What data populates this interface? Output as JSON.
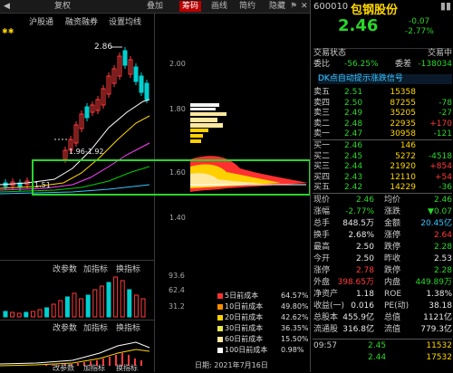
{
  "toolbar": {
    "back": "◀",
    "reinstate": "复权",
    "overlay": "叠加",
    "chips": "筹码",
    "draw": "画线",
    "brief": "简约",
    "hide": "隐藏",
    "flag": "⚑",
    "close": "✕"
  },
  "subtabs": {
    "hgt": "沪股通",
    "margin": "融资融券",
    "settings": "设置均线"
  },
  "price_axis": [
    "2.00",
    "1.80",
    "1.60",
    "1.40"
  ],
  "kline_labels": {
    "high": "2.86",
    "mid": "1.96-1.92",
    "low": "1.51",
    "stars": "✱✱"
  },
  "indicator": {
    "params": "改参数",
    "add": "加指标",
    "switch": "换指标"
  },
  "vol_axis": [
    "93.6",
    "62.4",
    "31.2"
  ],
  "chips_legend": [
    {
      "label": "5日前成本",
      "value": "64.57%",
      "color": "#ff3030"
    },
    {
      "label": "10日前成本",
      "value": "49.80%",
      "color": "#ff8c00"
    },
    {
      "label": "20日前成本",
      "value": "42.62%",
      "color": "#ffd000"
    },
    {
      "label": "30日前成本",
      "value": "36.35%",
      "color": "#e8e850"
    },
    {
      "label": "60日前成本",
      "value": "15.50%",
      "color": "#ffe8a0"
    },
    {
      "label": "100日前成本",
      "value": "0.98%",
      "color": "#ffffff"
    }
  ],
  "chips_date": "日期: 2021年7月16日",
  "quote": {
    "code": "600010",
    "name": "包钢股份",
    "price": "2.46",
    "change": "-0.07",
    "pct": "-2.77%",
    "status_label": "交易状态",
    "status_value": "交易中",
    "weibi_label": "委比",
    "weibi_pct": "-56.25%",
    "weibi_label2": "委差",
    "weibi_diff": "-138034",
    "signal": "DK点自动提示涨跌信号",
    "asks": [
      {
        "label": "卖五",
        "price": "2.51",
        "vol": "15358",
        "chg": ""
      },
      {
        "label": "卖四",
        "price": "2.50",
        "vol": "87255",
        "chg": "-78"
      },
      {
        "label": "卖三",
        "price": "2.49",
        "vol": "35205",
        "chg": "-27"
      },
      {
        "label": "卖二",
        "price": "2.48",
        "vol": "22935",
        "chg": "+170"
      },
      {
        "label": "卖一",
        "price": "2.47",
        "vol": "30958",
        "chg": "-121"
      }
    ],
    "bids": [
      {
        "label": "买一",
        "price": "2.46",
        "vol": "146",
        "chg": ""
      },
      {
        "label": "买二",
        "price": "2.45",
        "vol": "5272",
        "chg": "-4518"
      },
      {
        "label": "买三",
        "price": "2.44",
        "vol": "21920",
        "chg": "+854"
      },
      {
        "label": "买四",
        "price": "2.43",
        "vol": "12110",
        "chg": "+54"
      },
      {
        "label": "买五",
        "price": "2.42",
        "vol": "14229",
        "chg": "-36"
      }
    ],
    "stats": [
      {
        "l1": "现价",
        "v1": "2.46",
        "c1": "g",
        "l2": "均价",
        "v2": "2.46",
        "c2": "g"
      },
      {
        "l1": "涨幅",
        "v1": "-2.77%",
        "c1": "g",
        "l2": "涨跌",
        "v2": "▼0.07",
        "c2": "g"
      },
      {
        "l1": "总手",
        "v1": "848.5万",
        "c1": "w",
        "l2": "金额",
        "v2": "20.45亿",
        "c2": "c"
      },
      {
        "l1": "换手",
        "v1": "2.68%",
        "c1": "w",
        "l2": "涨停",
        "v2": "2.64",
        "c2": "r"
      },
      {
        "l1": "最高",
        "v1": "2.50",
        "c1": "w",
        "l2": "跌停",
        "v2": "2.28",
        "c2": "g"
      },
      {
        "l1": "今开",
        "v1": "2.50",
        "c1": "w",
        "l2": "昨收",
        "v2": "2.53",
        "c2": "w"
      },
      {
        "l1": "涨停",
        "v1": "2.78",
        "c1": "r",
        "l2": "跌停",
        "v2": "2.28",
        "c2": "g"
      },
      {
        "l1": "外盘",
        "v1": "398.65万",
        "c1": "r",
        "l2": "内盘",
        "v2": "449.89万",
        "c2": "g"
      },
      {
        "l1": "净资产",
        "v1": "1.18",
        "c1": "w",
        "l2": "ROE",
        "v2": "1.38%",
        "c2": "w"
      },
      {
        "l1": "收益(一)",
        "v1": "0.016",
        "c1": "w",
        "l2": "PE(动)",
        "v2": "38.18",
        "c2": "w"
      },
      {
        "l1": "总股本",
        "v1": "455.9亿",
        "c1": "w",
        "l2": "总值",
        "v2": "1121亿",
        "c2": "w"
      },
      {
        "l1": "流通股",
        "v1": "316.8亿",
        "c1": "w",
        "l2": "流值",
        "v2": "779.3亿",
        "c2": "w"
      }
    ],
    "ticks": [
      {
        "time": "09:57",
        "price": "2.45",
        "vol": "11532"
      },
      {
        "time": "",
        "price": "2.44",
        "vol": "17532"
      }
    ]
  }
}
